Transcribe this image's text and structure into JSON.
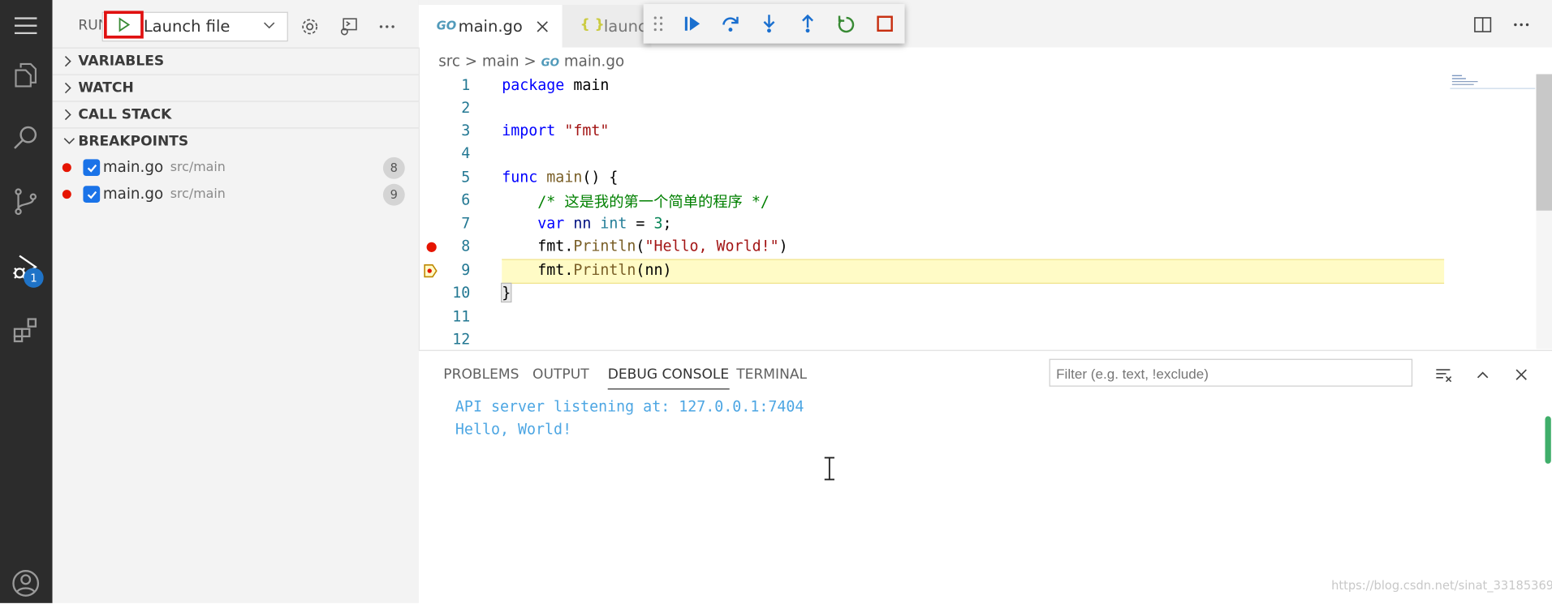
{
  "sidebar": {
    "run_label": "RUN",
    "config": "Launch file",
    "sections": {
      "variables": "VARIABLES",
      "watch": "WATCH",
      "call_stack": "CALL STACK",
      "breakpoints": "BREAKPOINTS"
    },
    "breakpoints": [
      {
        "file": "main.go",
        "path": "src/main",
        "line": "8"
      },
      {
        "file": "main.go",
        "path": "src/main",
        "line": "9"
      }
    ]
  },
  "activity": {
    "debug_badge": "1"
  },
  "tabs": [
    {
      "label": "main.go",
      "icon": "GO"
    },
    {
      "label": "launch",
      "icon": "{ }"
    }
  ],
  "breadcrumb": {
    "parts": [
      "src",
      "main",
      "main.go"
    ]
  },
  "code": {
    "line_numbers": [
      "1",
      "2",
      "3",
      "4",
      "5",
      "6",
      "7",
      "8",
      "9",
      "10",
      "11",
      "12"
    ],
    "l1_kw": "package",
    "l1_rest": " main",
    "l3_kw": "import",
    "l3_str": "\"fmt\"",
    "l5_kw": "func",
    "l5_fn": "main",
    "l5_rest": "() {",
    "l6": "    /* 这是我的第一个简单的程序 */",
    "l7_kw": "var",
    "l7_var": "nn",
    "l7_ty": "int",
    "l7_eq": " = ",
    "l7_num": "3",
    "l7_end": ";",
    "l8_pkg": "fmt.",
    "l8_fn": "Println",
    "l8_open": "(",
    "l8_str": "\"Hello, World!\"",
    "l8_close": ")",
    "l9_pkg": "fmt.",
    "l9_fn": "Println",
    "l9_rest": "(nn)",
    "l10": "}"
  },
  "panel": {
    "tabs": [
      "PROBLEMS",
      "OUTPUT",
      "DEBUG CONSOLE",
      "TERMINAL"
    ],
    "filter_placeholder": "Filter (e.g. text, !exclude)",
    "console": [
      "API server listening at: 127.0.0.1:7404",
      "Hello, World!"
    ]
  },
  "watermark": "https://blog.csdn.net/sinat_33185369"
}
